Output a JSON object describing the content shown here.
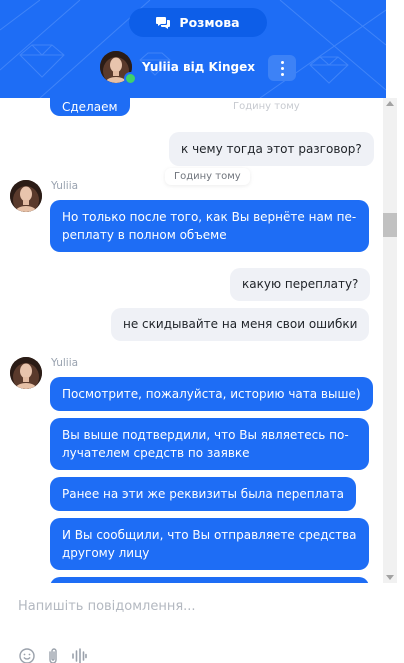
{
  "header": {
    "tab_label": "Розмова",
    "agent_name": "Yuliia від Kingex",
    "accent_color": "#1e6df5",
    "menu_icon": "more-vertical-icon",
    "tab_icon": "chat-bubbles-icon"
  },
  "messages": [
    {
      "direction": "in",
      "text": "Сделаем"
    },
    {
      "direction": "meta",
      "text": "Годину тому"
    },
    {
      "direction": "out",
      "text": "к чему тогда этот разговор?"
    },
    {
      "direction": "meta",
      "text": "Годину тому"
    },
    {
      "direction": "sender",
      "text": "Yuliia"
    },
    {
      "direction": "in",
      "lines": [
        "Но только после того, как Вы вернёте нам пе-",
        "реплату в полном объеме"
      ]
    },
    {
      "direction": "out",
      "text": "какую переплату?"
    },
    {
      "direction": "out",
      "text": "не скидывайте на меня свои ошибки"
    },
    {
      "direction": "sender",
      "text": "Yuliia"
    },
    {
      "direction": "in",
      "text": "Посмотрите, пожалуйста, историю чата выше)"
    },
    {
      "direction": "in",
      "lines": [
        "Вы выше подтвердили, что Вы являетесь по-",
        "лучателем средств по заявке"
      ]
    },
    {
      "direction": "in",
      "text": "Ранее на эти же реквизиты была переплата"
    },
    {
      "direction": "in",
      "lines": [
        "И Вы сообщили, что Вы отправляете средства",
        "другому лицу"
      ]
    }
  ],
  "composer": {
    "placeholder": "Напишіть повідомлення...",
    "value": "",
    "tools": [
      "emoji-icon",
      "attach-icon",
      "voice-icon"
    ]
  }
}
